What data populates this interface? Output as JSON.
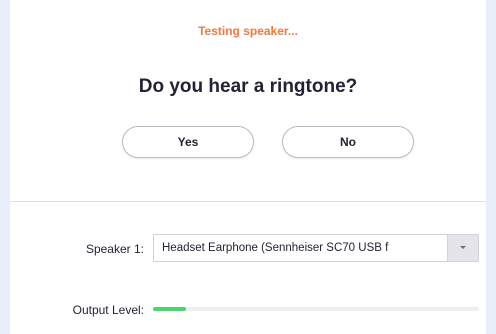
{
  "status": {
    "text": "Testing speaker..."
  },
  "prompt": {
    "question": "Do you hear a ringtone?"
  },
  "buttons": {
    "yes_label": "Yes",
    "no_label": "No"
  },
  "speaker": {
    "label": "Speaker 1:",
    "selected_value": "Headset Earphone (Sennheiser SC70 USB f",
    "dropdown_icon": "chevron-down-icon"
  },
  "output_level": {
    "label": "Output Level:",
    "level": 0.1
  },
  "colors": {
    "status": "#ee7a3f",
    "level_fill": "#4ad66e",
    "background": "#e8effa",
    "text": "#232333"
  }
}
